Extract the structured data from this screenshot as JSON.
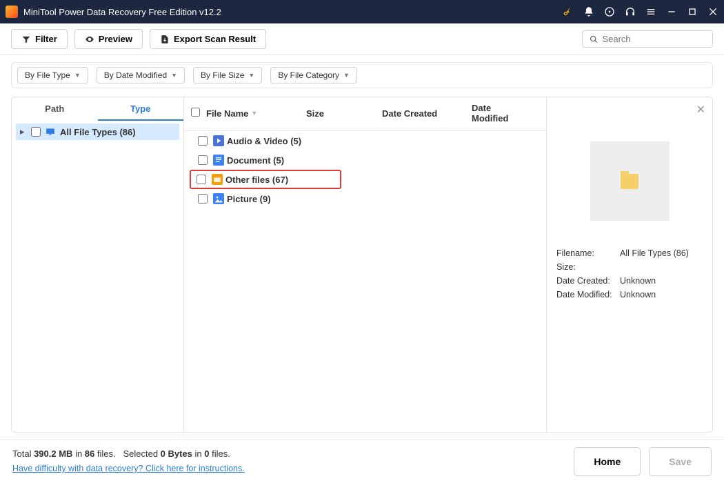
{
  "titlebar": {
    "title": "MiniTool Power Data Recovery Free Edition v12.2"
  },
  "toolbar": {
    "filter": "Filter",
    "preview": "Preview",
    "export": "Export Scan Result",
    "search_placeholder": "Search"
  },
  "filters": {
    "file_type": "By File Type",
    "date_modified": "By Date Modified",
    "file_size": "By File Size",
    "file_category": "By File Category"
  },
  "tabs": {
    "path": "Path",
    "type": "Type"
  },
  "tree": {
    "root_label": "All File Types (86)"
  },
  "columns": {
    "filename": "File Name",
    "size": "Size",
    "date_created": "Date Created",
    "date_modified": "Date Modified"
  },
  "items": [
    {
      "name": "Audio & Video (5)",
      "icon": "media"
    },
    {
      "name": "Document (5)",
      "icon": "doc"
    },
    {
      "name": "Other files (67)",
      "icon": "other",
      "highlight": true
    },
    {
      "name": "Picture (9)",
      "icon": "pic"
    }
  ],
  "preview": {
    "filename_label": "Filename:",
    "filename_value": "All File Types (86)",
    "size_label": "Size:",
    "size_value": "",
    "dc_label": "Date Created:",
    "dc_value": "Unknown",
    "dm_label": "Date Modified:",
    "dm_value": "Unknown"
  },
  "footer": {
    "total_prefix": "Total ",
    "total_size": "390.2 MB",
    "total_mid": " in ",
    "total_files": "86",
    "total_suffix": " files.",
    "selected_prefix": "Selected ",
    "selected_bytes": "0 Bytes",
    "selected_mid": " in ",
    "selected_files": "0",
    "selected_suffix": " files.",
    "help_link": "Have difficulty with data recovery? Click here for instructions.",
    "home": "Home",
    "save": "Save"
  }
}
